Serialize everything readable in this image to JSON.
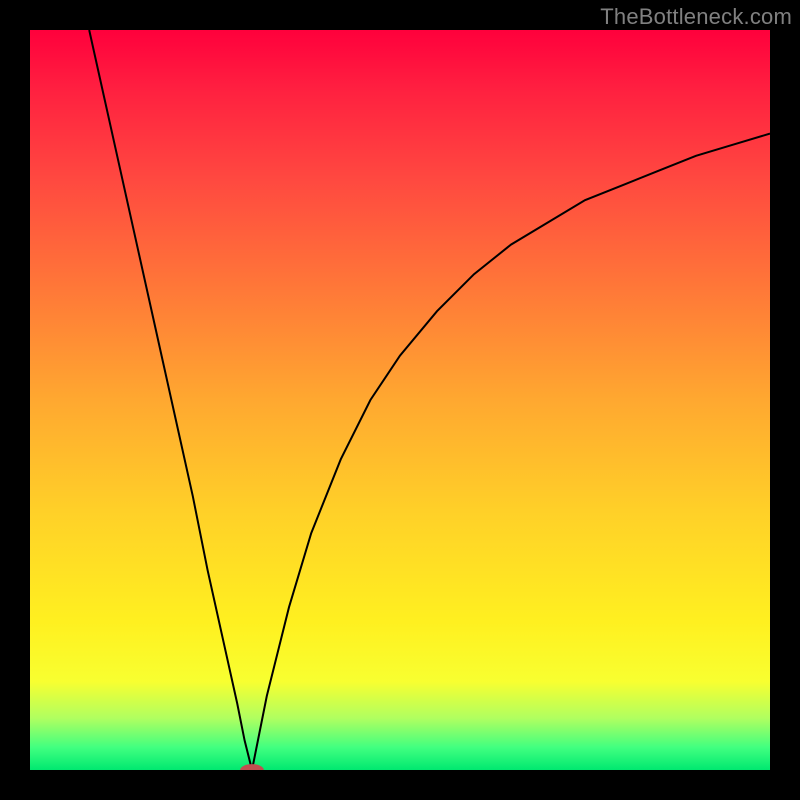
{
  "watermark": "TheBottleneck.com",
  "chart_data": {
    "type": "line",
    "title": "",
    "xlabel": "",
    "ylabel": "",
    "xlim": [
      0,
      100
    ],
    "ylim": [
      0,
      100
    ],
    "grid": false,
    "legend": false,
    "marker": {
      "x": 30,
      "y": 0,
      "color": "#c05050"
    },
    "series": [
      {
        "name": "left-branch",
        "x": [
          8,
          10,
          12,
          14,
          16,
          18,
          20,
          22,
          24,
          26,
          28,
          29,
          30
        ],
        "y": [
          100,
          91,
          82,
          73,
          64,
          55,
          46,
          37,
          27,
          18,
          9,
          4,
          0
        ]
      },
      {
        "name": "right-branch",
        "x": [
          30,
          31,
          32,
          33,
          35,
          38,
          42,
          46,
          50,
          55,
          60,
          65,
          70,
          75,
          80,
          85,
          90,
          95,
          100
        ],
        "y": [
          0,
          5,
          10,
          14,
          22,
          32,
          42,
          50,
          56,
          62,
          67,
          71,
          74,
          77,
          79,
          81,
          83,
          84.5,
          86
        ]
      }
    ],
    "background_gradient": {
      "direction": "vertical",
      "stops": [
        {
          "pos": 0.0,
          "color": "#ff003c"
        },
        {
          "pos": 0.5,
          "color": "#ffa830"
        },
        {
          "pos": 0.85,
          "color": "#fff020"
        },
        {
          "pos": 1.0,
          "color": "#00e870"
        }
      ]
    }
  }
}
